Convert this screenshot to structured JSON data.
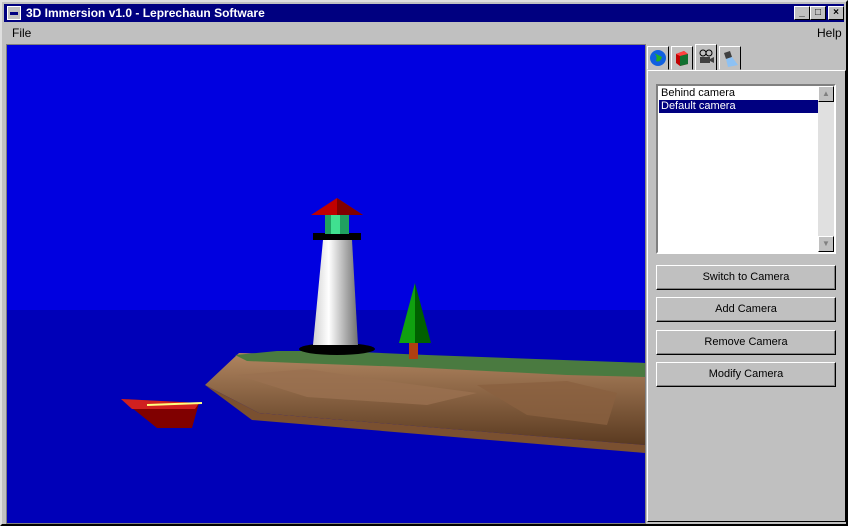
{
  "window": {
    "title": "3D Immersion v1.0 - Leprechaun Software"
  },
  "titlebar_buttons": {
    "minimize": "_",
    "maximize": "□",
    "close": "×"
  },
  "menu": {
    "file": "File",
    "help": "Help"
  },
  "tabs": [
    {
      "icon": "globe-icon"
    },
    {
      "icon": "cube-icon"
    },
    {
      "icon": "camera-icon",
      "active": true
    },
    {
      "icon": "spotlight-icon"
    }
  ],
  "cameras": {
    "items": [
      "Behind camera",
      "Default camera"
    ],
    "selected": "Default camera"
  },
  "buttons": {
    "switch": "Switch to Camera",
    "add": "Add Camera",
    "remove": "Remove Camera",
    "modify": "Modify Camera"
  },
  "colors": {
    "sky": "#0000e0",
    "sea": "#0000b8",
    "titlebar": "#000080"
  }
}
